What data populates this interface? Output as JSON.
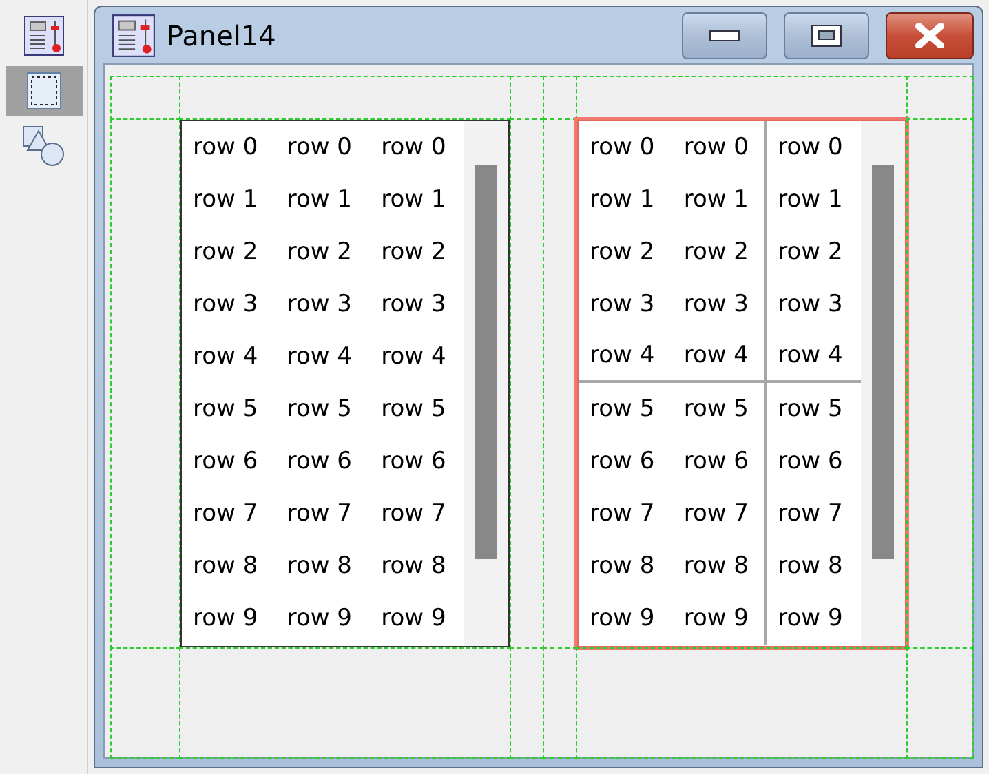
{
  "toolbar": [
    {
      "kind": "form",
      "selected": false
    },
    {
      "kind": "frame",
      "selected": true
    },
    {
      "kind": "shapes",
      "selected": false
    }
  ],
  "window": {
    "title": "Panel14"
  },
  "tables": [
    {
      "selected": false,
      "rows": [
        [
          "row 0",
          "row 0",
          "row 0"
        ],
        [
          "row 1",
          "row 1",
          "row 1"
        ],
        [
          "row 2",
          "row 2",
          "row 2"
        ],
        [
          "row 3",
          "row 3",
          "row 3"
        ],
        [
          "row 4",
          "row 4",
          "row 4"
        ],
        [
          "row 5",
          "row 5",
          "row 5"
        ],
        [
          "row 6",
          "row 6",
          "row 6"
        ],
        [
          "row 7",
          "row 7",
          "row 7"
        ],
        [
          "row 8",
          "row 8",
          "row 8"
        ],
        [
          "row 9",
          "row 9",
          "row 9"
        ]
      ]
    },
    {
      "selected": true,
      "rows": [
        [
          "row 0",
          "row 0",
          "row 0"
        ],
        [
          "row 1",
          "row 1",
          "row 1"
        ],
        [
          "row 2",
          "row 2",
          "row 2"
        ],
        [
          "row 3",
          "row 3",
          "row 3"
        ],
        [
          "row 4",
          "row 4",
          "row 4"
        ],
        [
          "row 5",
          "row 5",
          "row 5"
        ],
        [
          "row 6",
          "row 6",
          "row 6"
        ],
        [
          "row 7",
          "row 7",
          "row 7"
        ],
        [
          "row 8",
          "row 8",
          "row 8"
        ],
        [
          "row 9",
          "row 9",
          "row 9"
        ]
      ]
    }
  ]
}
